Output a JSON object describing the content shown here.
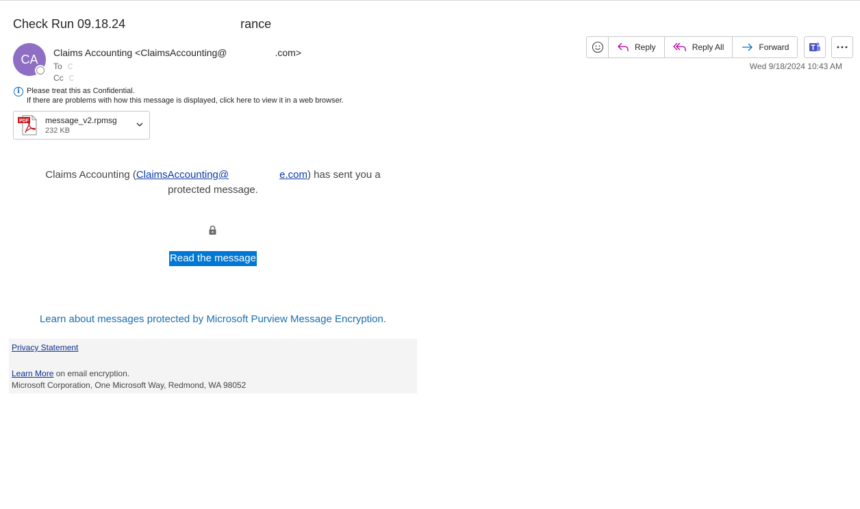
{
  "email": {
    "subject_prefix": "Check Run 09.18.24",
    "subject_suffix": "rance",
    "avatar_initials": "CA",
    "sender_prefix": "Claims Accounting <ClaimsAccounting@",
    "sender_suffix": ".com>",
    "to_label": "To",
    "cc_label": "Cc",
    "info_line1": "Please treat this as Confidential.",
    "info_line2": "If there are problems with how this message is displayed, click here to view it in a web browser.",
    "timestamp": "Wed 9/18/2024 10:43 AM"
  },
  "attachment": {
    "name": "message_v2.rpmsg",
    "size": "232 KB",
    "icon_label": "PDF"
  },
  "toolbar": {
    "reply": "Reply",
    "reply_all": "Reply All",
    "forward": "Forward"
  },
  "body": {
    "intro_prefix": "Claims Accounting (",
    "link_prefix": "ClaimsAccounting@",
    "link_suffix": "e.com",
    "intro_suffix": ") has sent you a",
    "intro_line2": "protected message.",
    "read_button": "Read the message",
    "learn_purview": "Learn about messages protected by Microsoft Purview Message Encryption."
  },
  "footer": {
    "privacy": "Privacy Statement",
    "learn_more": "Learn More",
    "learn_more_suffix": " on email encryption.",
    "address": "Microsoft Corporation, One Microsoft Way, Redmond, WA 98052"
  },
  "colors": {
    "avatar": "#8e6fc4",
    "accent": "#0078d4",
    "reply_icon": "#b4009e",
    "forward_icon": "#0f6cbd",
    "teams": "#4b53bc"
  }
}
